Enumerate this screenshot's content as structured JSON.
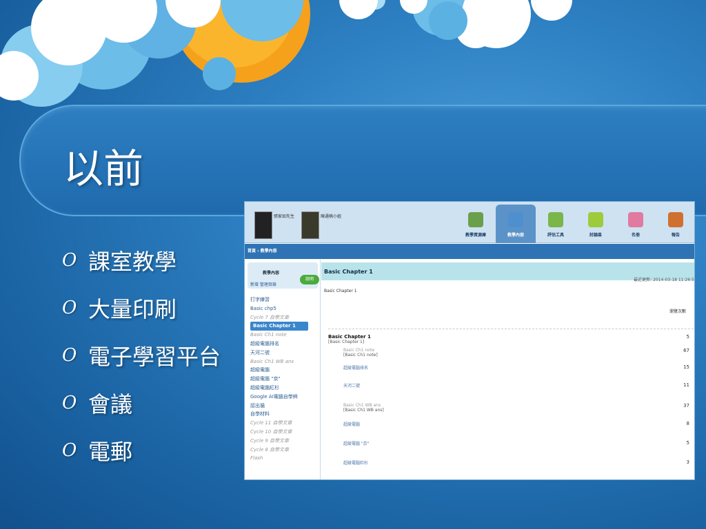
{
  "slide": {
    "title": "以前",
    "bullet_marker": "O",
    "bullets": [
      "課室教學",
      "大量印刷",
      "電子學習平台",
      "會議",
      "電郵"
    ]
  },
  "screenshot": {
    "users": [
      "張家如先生",
      "陳通楠小姐"
    ],
    "nav_tabs": [
      {
        "label": "教學資源庫",
        "color": "#6aa04a"
      },
      {
        "label": "教學內容",
        "color": "#4f8fd0",
        "active": true
      },
      {
        "label": "評估工具",
        "color": "#7ab648"
      },
      {
        "label": "討論區",
        "color": "#9ccc3c"
      },
      {
        "label": "名冊",
        "color": "#e07aa0"
      },
      {
        "label": "報告",
        "color": "#d07030"
      }
    ],
    "breadcrumb": "首頁 › 教學內容",
    "sidebar": {
      "title": "教學內容",
      "help": "說明",
      "tools": "新增  管理目錄",
      "tree": [
        {
          "label": "打字練習"
        },
        {
          "label": "Basic chp5"
        },
        {
          "label": "Cycle 7 自學文章",
          "italic": true
        },
        {
          "label": "Basic Chapter 1",
          "selected": true
        },
        {
          "label": "Basic Ch1 note",
          "italic": true
        },
        {
          "label": "超級電腦排名"
        },
        {
          "label": "天河二號"
        },
        {
          "label": "Basic Ch1 WB ans",
          "italic": true
        },
        {
          "label": "超級電腦"
        },
        {
          "label": "超級電腦 \"京\""
        },
        {
          "label": "超級電腦紅杉"
        },
        {
          "label": "Google AI電腦自學辨"
        },
        {
          "label": "認出貓"
        },
        {
          "label": "自學材料"
        },
        {
          "label": "Cycle 11 自學文章",
          "italic": true
        },
        {
          "label": "Cycle 10 自學文章",
          "italic": true
        },
        {
          "label": "Cycle 9 自學文章",
          "italic": true
        },
        {
          "label": "Cycle 8 自學文章",
          "italic": true
        },
        {
          "label": "Flash",
          "italic": true
        }
      ]
    },
    "content": {
      "title": "Basic Chapter 1",
      "updated": "最近更新: 2014-03-18 11:26:5",
      "subtitle": "Basic Chapter 1",
      "col_header": "瀏覽次數",
      "rows": [
        {
          "title": "Basic Chapter 1",
          "sub": "[Basic Chapter 1]",
          "count": "5"
        },
        {
          "title": "Basic Ch1 note",
          "sub": "[Basic Ch1 note]",
          "count": "67"
        },
        {
          "title": "超級電腦排名",
          "sub": "",
          "count": "15"
        },
        {
          "title": "天河二號",
          "sub": "",
          "count": "11"
        },
        {
          "title": "Basic Ch1 WB ans",
          "sub": "[Basic Ch1 WB ans]",
          "count": "37"
        },
        {
          "title": "超級電腦",
          "sub": "",
          "count": "8"
        },
        {
          "title": "超級電腦 \"京\"",
          "sub": "",
          "count": "5"
        },
        {
          "title": "超級電腦紅杉",
          "sub": "",
          "count": "3"
        }
      ]
    }
  }
}
